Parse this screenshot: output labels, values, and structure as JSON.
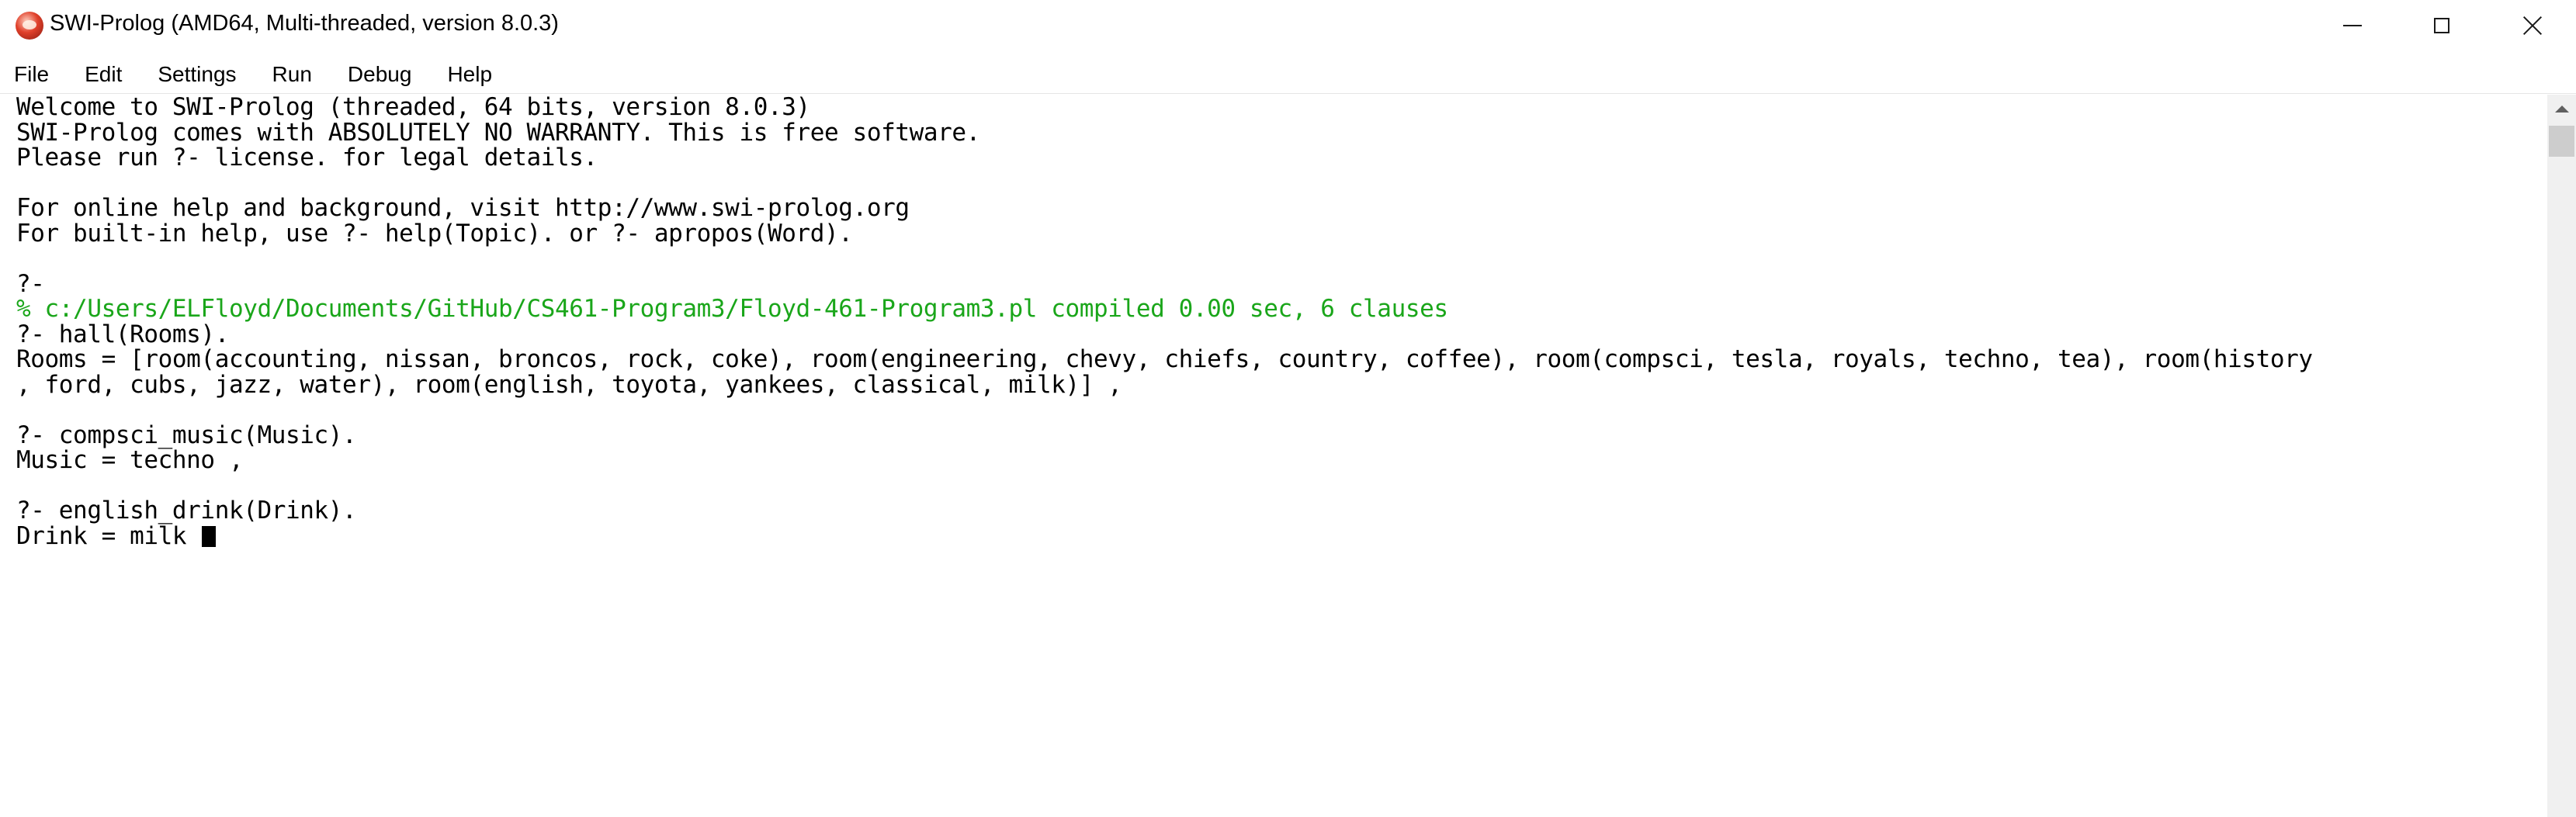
{
  "window": {
    "title": "SWI-Prolog (AMD64, Multi-threaded, version 8.0.3)",
    "icon": "swi-prolog-owl-icon",
    "controls": {
      "minimize": "minimize-icon",
      "maximize": "maximize-icon",
      "close": "close-icon"
    }
  },
  "menu": {
    "items": [
      {
        "label": "File"
      },
      {
        "label": "Edit"
      },
      {
        "label": "Settings"
      },
      {
        "label": "Run"
      },
      {
        "label": "Debug"
      },
      {
        "label": "Help"
      }
    ]
  },
  "console": {
    "prompt_color": "#000000",
    "message_color": "#1aa61a",
    "lines": [
      {
        "text": "Welcome to SWI-Prolog (threaded, 64 bits, version 8.0.3)"
      },
      {
        "text": "SWI-Prolog comes with ABSOLUTELY NO WARRANTY. This is free software."
      },
      {
        "text": "Please run ?- license. for legal details."
      },
      {
        "text": ""
      },
      {
        "text": "For online help and background, visit http://www.swi-prolog.org"
      },
      {
        "text": "For built-in help, use ?- help(Topic). or ?- apropos(Word)."
      },
      {
        "text": ""
      },
      {
        "text": "?-"
      },
      {
        "text": "% c:/Users/ELFloyd/Documents/GitHub/CS461-Program3/Floyd-461-Program3.pl compiled 0.00 sec, 6 clauses"
      },
      {
        "text": "?- hall(Rooms)."
      },
      {
        "text": "Rooms = [room(accounting, nissan, broncos, rock, coke), room(engineering, chevy, chiefs, country, coffee), room(compsci, tesla, royals, techno, tea), room(history"
      },
      {
        "text": ", ford, cubs, jazz, water), room(english, toyota, yankees, classical, milk)] ,"
      },
      {
        "text": ""
      },
      {
        "text": "?- compsci_music(Music)."
      },
      {
        "text": "Music = techno ,"
      },
      {
        "text": ""
      },
      {
        "text": "?- english_drink(Drink)."
      },
      {
        "text": "Drink = milk "
      }
    ]
  }
}
